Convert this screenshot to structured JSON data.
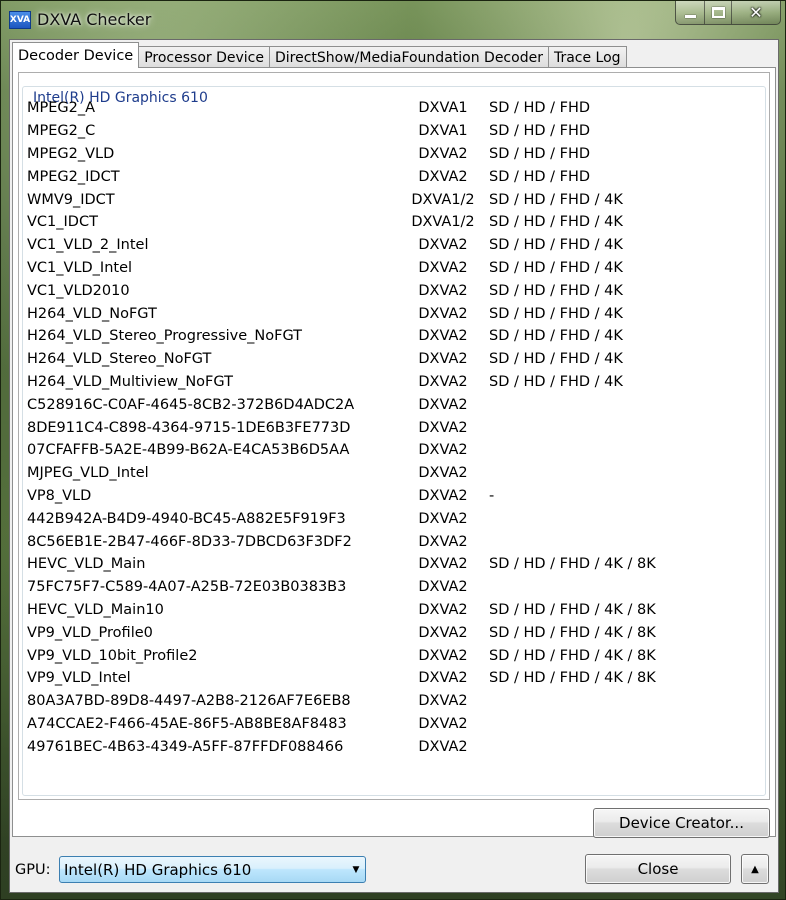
{
  "window": {
    "title": "DXVA Checker",
    "icon_text": "XVA"
  },
  "tabs": [
    {
      "label": "Decoder Device",
      "active": true
    },
    {
      "label": "Processor Device"
    },
    {
      "label": "DirectShow/MediaFoundation Decoder"
    },
    {
      "label": "Trace Log"
    }
  ],
  "device": {
    "name": "Intel(R) HD Graphics 610"
  },
  "decoders": [
    {
      "name": "MPEG2_A",
      "dxva": "DXVA1",
      "res": "SD / HD / FHD"
    },
    {
      "name": "MPEG2_C",
      "dxva": "DXVA1",
      "res": "SD / HD / FHD"
    },
    {
      "name": "MPEG2_VLD",
      "dxva": "DXVA2",
      "res": "SD / HD / FHD"
    },
    {
      "name": "MPEG2_IDCT",
      "dxva": "DXVA2",
      "res": "SD / HD / FHD"
    },
    {
      "name": "WMV9_IDCT",
      "dxva": "DXVA1/2",
      "res": "SD / HD / FHD / 4K"
    },
    {
      "name": "VC1_IDCT",
      "dxva": "DXVA1/2",
      "res": "SD / HD / FHD / 4K"
    },
    {
      "name": "VC1_VLD_2_Intel",
      "dxva": "DXVA2",
      "res": "SD / HD / FHD / 4K"
    },
    {
      "name": "VC1_VLD_Intel",
      "dxva": "DXVA2",
      "res": "SD / HD / FHD / 4K"
    },
    {
      "name": "VC1_VLD2010",
      "dxva": "DXVA2",
      "res": "SD / HD / FHD / 4K"
    },
    {
      "name": "H264_VLD_NoFGT",
      "dxva": "DXVA2",
      "res": "SD / HD / FHD / 4K"
    },
    {
      "name": "H264_VLD_Stereo_Progressive_NoFGT",
      "dxva": "DXVA2",
      "res": "SD / HD / FHD / 4K"
    },
    {
      "name": "H264_VLD_Stereo_NoFGT",
      "dxva": "DXVA2",
      "res": "SD / HD / FHD / 4K"
    },
    {
      "name": "H264_VLD_Multiview_NoFGT",
      "dxva": "DXVA2",
      "res": "SD / HD / FHD / 4K"
    },
    {
      "name": "C528916C-C0AF-4645-8CB2-372B6D4ADC2A",
      "dxva": "DXVA2",
      "res": ""
    },
    {
      "name": "8DE911C4-C898-4364-9715-1DE6B3FE773D",
      "dxva": "DXVA2",
      "res": ""
    },
    {
      "name": "07CFAFFB-5A2E-4B99-B62A-E4CA53B6D5AA",
      "dxva": "DXVA2",
      "res": ""
    },
    {
      "name": "MJPEG_VLD_Intel",
      "dxva": "DXVA2",
      "res": ""
    },
    {
      "name": "VP8_VLD",
      "dxva": "DXVA2",
      "res": "-"
    },
    {
      "name": "442B942A-B4D9-4940-BC45-A882E5F919F3",
      "dxva": "DXVA2",
      "res": ""
    },
    {
      "name": "8C56EB1E-2B47-466F-8D33-7DBCD63F3DF2",
      "dxva": "DXVA2",
      "res": ""
    },
    {
      "name": "HEVC_VLD_Main",
      "dxva": "DXVA2",
      "res": "SD / HD / FHD / 4K / 8K"
    },
    {
      "name": "75FC75F7-C589-4A07-A25B-72E03B0383B3",
      "dxva": "DXVA2",
      "res": ""
    },
    {
      "name": "HEVC_VLD_Main10",
      "dxva": "DXVA2",
      "res": "SD / HD / FHD / 4K / 8K"
    },
    {
      "name": "VP9_VLD_Profile0",
      "dxva": "DXVA2",
      "res": "SD / HD / FHD / 4K / 8K"
    },
    {
      "name": "VP9_VLD_10bit_Profile2",
      "dxva": "DXVA2",
      "res": "SD / HD / FHD / 4K / 8K"
    },
    {
      "name": "VP9_VLD_Intel",
      "dxva": "DXVA2",
      "res": "SD / HD / FHD / 4K / 8K"
    },
    {
      "name": "80A3A7BD-89D8-4497-A2B8-2126AF7E6EB8",
      "dxva": "DXVA2",
      "res": ""
    },
    {
      "name": "A74CCAE2-F466-45AE-86F5-AB8BE8AF8483",
      "dxva": "DXVA2",
      "res": ""
    },
    {
      "name": "49761BEC-4B63-4349-A5FF-87FFDF088466",
      "dxva": "DXVA2",
      "res": ""
    }
  ],
  "buttons": {
    "device_creator": "Device Creator...",
    "close": "Close",
    "up": "▲"
  },
  "gpu": {
    "label": "GPU:",
    "selected": "Intel(R) HD Graphics 610",
    "arrow": "▼"
  }
}
